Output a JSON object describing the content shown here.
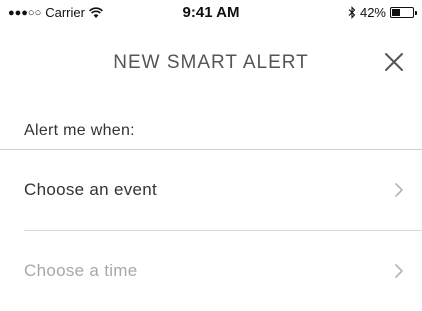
{
  "status_bar": {
    "signal_dots": "●●●○○",
    "carrier": "Carrier",
    "time": "9:41 AM",
    "battery_percent_label": "42%",
    "battery_level": 0.42,
    "icons": [
      "wifi-icon",
      "bluetooth-icon",
      "battery-icon"
    ]
  },
  "header": {
    "title": "NEW SMART ALERT",
    "close_icon": "close-icon"
  },
  "form": {
    "section_label": "Alert me when:",
    "rows": [
      {
        "label": "Choose an event",
        "enabled": true,
        "icon": "chevron-right-icon"
      },
      {
        "label": "Choose a time",
        "enabled": false,
        "icon": "chevron-right-icon"
      }
    ]
  },
  "colors": {
    "text_primary": "#333333",
    "text_disabled": "#a8a8a8",
    "title": "#555555",
    "divider": "#cfcfcf",
    "chevron": "#b5b5b5"
  }
}
